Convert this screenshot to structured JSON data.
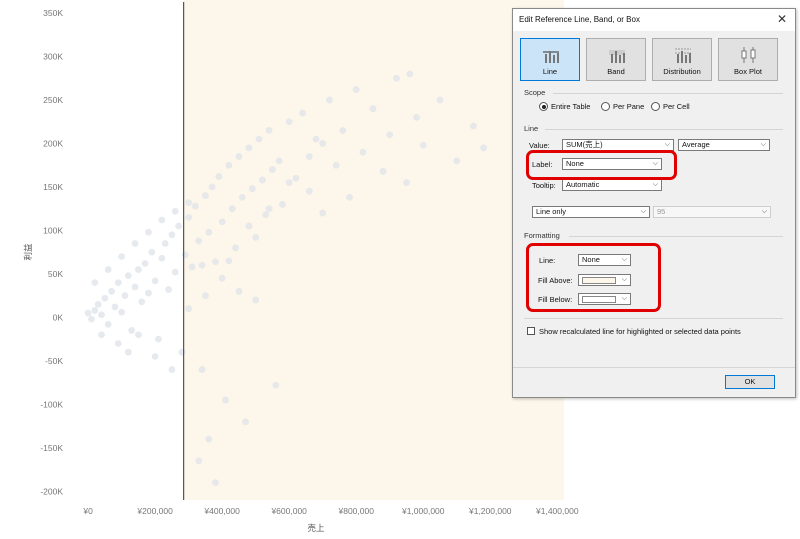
{
  "chart_data": {
    "type": "scatter",
    "xlabel": "売上",
    "ylabel": "利益",
    "xlim": [
      -60000,
      1420000
    ],
    "ylim": [
      -210000,
      365000
    ],
    "x_ticks": [
      {
        "value": 0,
        "label": "¥0"
      },
      {
        "value": 200000,
        "label": "¥200,000"
      },
      {
        "value": 400000,
        "label": "¥400,000"
      },
      {
        "value": 600000,
        "label": "¥600,000"
      },
      {
        "value": 800000,
        "label": "¥800,000"
      },
      {
        "value": 1000000,
        "label": "¥1,000,000"
      },
      {
        "value": 1200000,
        "label": "¥1,200,000"
      },
      {
        "value": 1400000,
        "label": "¥1,400,000"
      }
    ],
    "y_ticks": [
      {
        "value": 350000,
        "label": "350K"
      },
      {
        "value": 300000,
        "label": "300K"
      },
      {
        "value": 250000,
        "label": "250K"
      },
      {
        "value": 200000,
        "label": "200K"
      },
      {
        "value": 150000,
        "label": "150K"
      },
      {
        "value": 100000,
        "label": "100K"
      },
      {
        "value": 50000,
        "label": "50K"
      },
      {
        "value": 0,
        "label": "0K"
      },
      {
        "value": -50000,
        "label": "-50K"
      },
      {
        "value": -100000,
        "label": "-100K"
      },
      {
        "value": -150000,
        "label": "-150K"
      },
      {
        "value": -200000,
        "label": "-200K"
      }
    ],
    "reference_line_x": 285000,
    "fill_above_color": "#fdf6ea",
    "point_color": "#dde3ea",
    "grid": false,
    "points": [
      [
        0,
        5000
      ],
      [
        10000,
        -2000
      ],
      [
        20000,
        8000
      ],
      [
        30000,
        15000
      ],
      [
        40000,
        3000
      ],
      [
        50000,
        22000
      ],
      [
        60000,
        -8000
      ],
      [
        70000,
        30000
      ],
      [
        80000,
        12000
      ],
      [
        90000,
        40000
      ],
      [
        100000,
        6000
      ],
      [
        110000,
        25000
      ],
      [
        120000,
        48000
      ],
      [
        130000,
        -15000
      ],
      [
        140000,
        35000
      ],
      [
        150000,
        55000
      ],
      [
        160000,
        18000
      ],
      [
        170000,
        62000
      ],
      [
        180000,
        28000
      ],
      [
        190000,
        75000
      ],
      [
        200000,
        42000
      ],
      [
        210000,
        -25000
      ],
      [
        220000,
        68000
      ],
      [
        230000,
        85000
      ],
      [
        240000,
        32000
      ],
      [
        250000,
        95000
      ],
      [
        260000,
        52000
      ],
      [
        270000,
        105000
      ],
      [
        280000,
        -40000
      ],
      [
        290000,
        72000
      ],
      [
        300000,
        115000
      ],
      [
        310000,
        58000
      ],
      [
        320000,
        128000
      ],
      [
        330000,
        88000
      ],
      [
        340000,
        -60000
      ],
      [
        350000,
        140000
      ],
      [
        360000,
        98000
      ],
      [
        370000,
        150000
      ],
      [
        380000,
        64000
      ],
      [
        390000,
        162000
      ],
      [
        400000,
        110000
      ],
      [
        410000,
        -95000
      ],
      [
        420000,
        175000
      ],
      [
        430000,
        125000
      ],
      [
        440000,
        80000
      ],
      [
        450000,
        185000
      ],
      [
        460000,
        138000
      ],
      [
        470000,
        -120000
      ],
      [
        480000,
        195000
      ],
      [
        490000,
        148000
      ],
      [
        500000,
        92000
      ],
      [
        510000,
        205000
      ],
      [
        520000,
        158000
      ],
      [
        530000,
        118000
      ],
      [
        540000,
        215000
      ],
      [
        550000,
        170000
      ],
      [
        560000,
        -78000
      ],
      [
        570000,
        180000
      ],
      [
        580000,
        130000
      ],
      [
        600000,
        225000
      ],
      [
        620000,
        160000
      ],
      [
        640000,
        235000
      ],
      [
        660000,
        145000
      ],
      [
        680000,
        205000
      ],
      [
        700000,
        120000
      ],
      [
        720000,
        250000
      ],
      [
        740000,
        175000
      ],
      [
        760000,
        215000
      ],
      [
        780000,
        138000
      ],
      [
        800000,
        262000
      ],
      [
        820000,
        190000
      ],
      [
        850000,
        240000
      ],
      [
        880000,
        168000
      ],
      [
        900000,
        210000
      ],
      [
        920000,
        275000
      ],
      [
        950000,
        155000
      ],
      [
        980000,
        230000
      ],
      [
        1000000,
        198000
      ],
      [
        1050000,
        250000
      ],
      [
        1100000,
        180000
      ],
      [
        1150000,
        220000
      ],
      [
        1180000,
        195000
      ],
      [
        960000,
        280000
      ],
      [
        380000,
        -190000
      ],
      [
        330000,
        -165000
      ],
      [
        360000,
        -140000
      ],
      [
        250000,
        -60000
      ],
      [
        150000,
        -20000
      ],
      [
        20000,
        40000
      ],
      [
        60000,
        55000
      ],
      [
        100000,
        70000
      ],
      [
        140000,
        85000
      ],
      [
        180000,
        98000
      ],
      [
        220000,
        112000
      ],
      [
        260000,
        122000
      ],
      [
        300000,
        132000
      ],
      [
        340000,
        60000
      ],
      [
        400000,
        45000
      ],
      [
        450000,
        30000
      ],
      [
        500000,
        20000
      ],
      [
        90000,
        -30000
      ],
      [
        120000,
        -40000
      ],
      [
        200000,
        -45000
      ],
      [
        40000,
        -20000
      ],
      [
        300000,
        10000
      ],
      [
        350000,
        25000
      ],
      [
        420000,
        65000
      ],
      [
        480000,
        105000
      ],
      [
        540000,
        125000
      ],
      [
        600000,
        155000
      ],
      [
        660000,
        185000
      ],
      [
        700000,
        200000
      ]
    ]
  },
  "dialog": {
    "title": "Edit Reference Line, Band, or Box",
    "close_glyph": "✕",
    "types": [
      {
        "label": "Line",
        "icon": "line-chart-icon"
      },
      {
        "label": "Band",
        "icon": "band-chart-icon"
      },
      {
        "label": "Distribution",
        "icon": "distribution-chart-icon"
      },
      {
        "label": "Box Plot",
        "icon": "box-plot-icon"
      }
    ],
    "scope": {
      "header": "Scope",
      "options": [
        "Entire Table",
        "Per Pane",
        "Per Cell"
      ],
      "selected": "Entire Table"
    },
    "line": {
      "header": "Line",
      "value_label": "Value:",
      "value_field": "SUM(売上)",
      "aggregation": "Average",
      "label_label": "Label:",
      "label_value": "None",
      "tooltip_label": "Tooltip:",
      "tooltip_value": "Automatic",
      "line_type": "Line only",
      "confidence": "95"
    },
    "formatting": {
      "header": "Formatting",
      "line_label": "Line:",
      "line_value": "None",
      "fill_above_label": "Fill Above:",
      "fill_below_label": "Fill Below:",
      "fill_above_color": "#fdf6ea",
      "fill_below_color": "#ffffff"
    },
    "recalc_checkbox": {
      "label": "Show recalculated line for highlighted or selected data points",
      "checked": false
    },
    "ok_label": "OK",
    "highlight_color": "#e00000"
  }
}
